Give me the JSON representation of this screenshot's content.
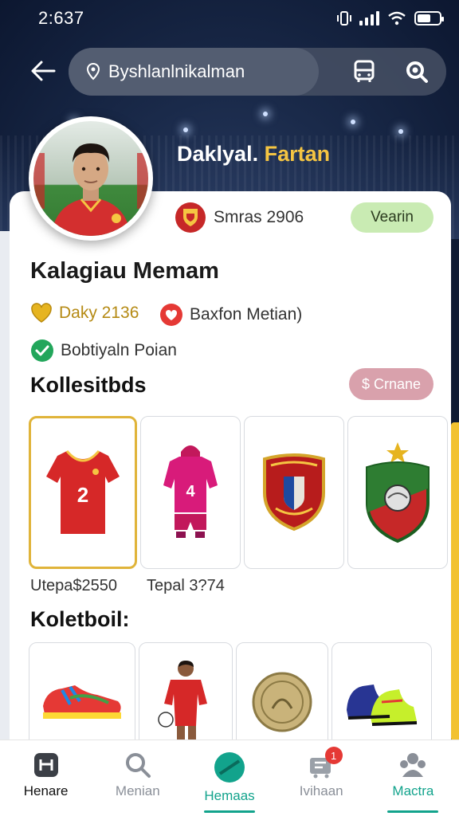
{
  "status_bar": {
    "time": "2:637"
  },
  "search": {
    "value": "Byshlanlnikalman"
  },
  "profile": {
    "name_part1": "Daklyal.",
    "name_part2": "Fartan"
  },
  "card": {
    "meta_text": "Smras 2906",
    "verify_label": "Vearin",
    "title": "Kalagiau Memam",
    "stat1": "Daky 2136",
    "stat2": "Baxfon Metian)",
    "stat3": "Bobtiyaln Poian",
    "section1_title": "Kollesitbds",
    "section1_action": "$ Crnane",
    "caption1": "Utepa$2550",
    "caption2": "Tepal 3?74",
    "section2_title": "Koletboil:"
  },
  "tiles_row1": [
    {
      "icon": "red-jersey-2-icon",
      "number": "2"
    },
    {
      "icon": "pink-kit-4-icon",
      "number": "4"
    },
    {
      "icon": "red-crest-icon"
    },
    {
      "icon": "green-crest-icon"
    }
  ],
  "tiles_row2": [
    {
      "icon": "sneakers-icon"
    },
    {
      "icon": "player-figure-icon"
    },
    {
      "icon": "medal-icon"
    },
    {
      "icon": "football-boots-icon"
    }
  ],
  "nav": [
    {
      "label": "Henare",
      "icon": "home-icon"
    },
    {
      "label": "Menian",
      "icon": "search-icon"
    },
    {
      "label": "Hemaas",
      "icon": "field-icon"
    },
    {
      "label": "Ivihaan",
      "icon": "cart-icon",
      "badge": "1"
    },
    {
      "label": "Mactra",
      "icon": "people-icon"
    }
  ],
  "colors": {
    "accent": "#12a38c",
    "gold": "#e0b43a",
    "verify_bg": "#c9ebb3",
    "pill_bg": "#d9a1ac"
  }
}
